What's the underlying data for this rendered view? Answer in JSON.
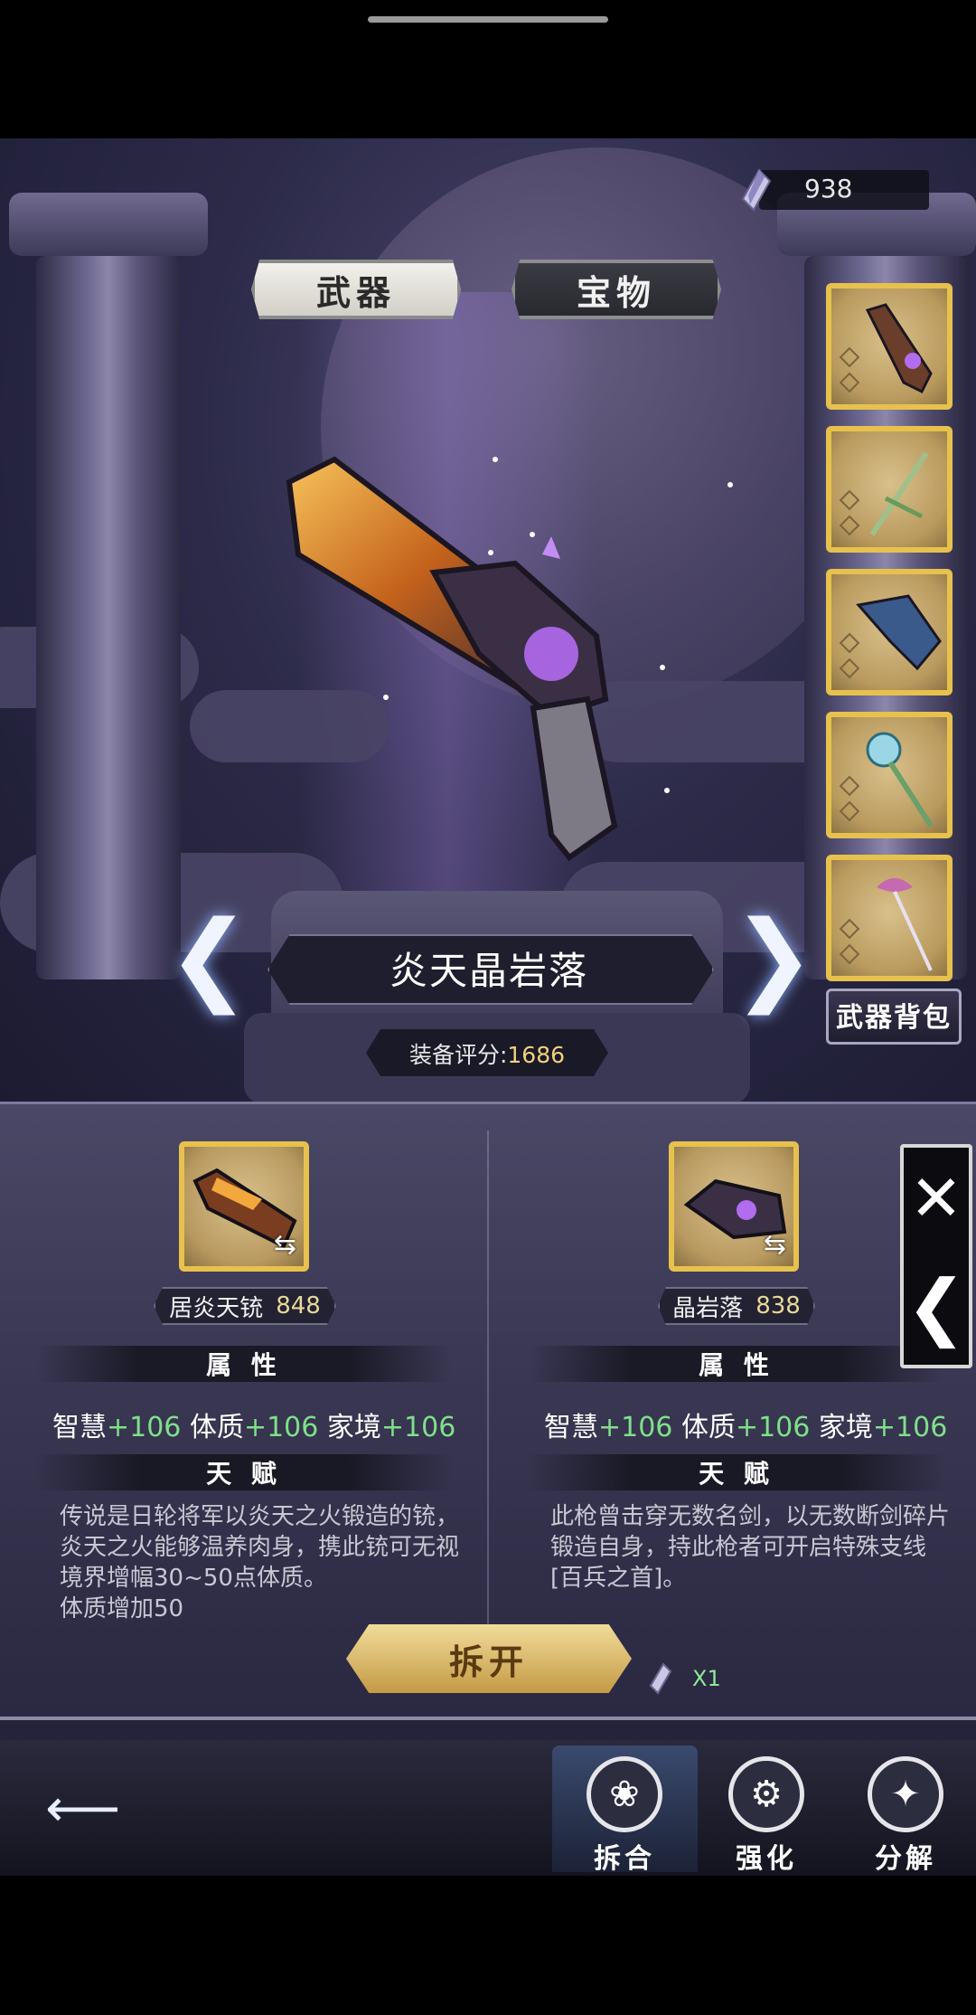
{
  "currency": {
    "amount": "938"
  },
  "tabs": {
    "weapon": "武器",
    "treasure": "宝物"
  },
  "current_weapon": {
    "name": "炎天晶岩落",
    "score_label": "装备评分:",
    "score_value": "1686"
  },
  "weapon_bag": {
    "label": "武器背包"
  },
  "left_item": {
    "name": "居炎天铳",
    "score": "848",
    "attr_title": "属 性",
    "stats": [
      {
        "label": "智慧",
        "value": "+106"
      },
      {
        "label": "体质",
        "value": "+106"
      },
      {
        "label": "家境",
        "value": "+106"
      }
    ],
    "talent_title": "天 赋",
    "talent_desc": "传说是日轮将军以炎天之火锻造的铳，\n炎天之火能够温养肉身，携此铳可无视\n境界增幅30~50点体质。\n体质增加50"
  },
  "right_item": {
    "name": "晶岩落",
    "score": "838",
    "attr_title": "属 性",
    "stats": [
      {
        "label": "智慧",
        "value": "+106"
      },
      {
        "label": "体质",
        "value": "+106"
      },
      {
        "label": "家境",
        "value": "+106"
      }
    ],
    "talent_title": "天 赋",
    "talent_desc": "此枪曾击穿无数名剑，以无数断剑碎片\n锻造自身，持此枪者可开启特殊支线\n[百兵之首]。"
  },
  "dismantle": {
    "label": "拆开",
    "cost": "X1"
  },
  "bottom_nav": {
    "split": "拆合",
    "enhance": "强化",
    "decompose": "分解"
  },
  "colors": {
    "gold": "#e7c14d",
    "green": "#7fe08a",
    "score": "#f0d27a"
  }
}
